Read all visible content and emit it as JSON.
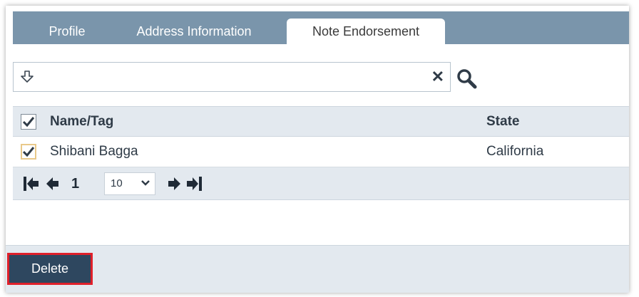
{
  "tabs": [
    {
      "label": "Profile",
      "active": false
    },
    {
      "label": "Address Information",
      "active": false
    },
    {
      "label": "Note Endorsement",
      "active": true
    }
  ],
  "search": {
    "value": "",
    "filter_icon": "filter-arrow-icon",
    "clear_icon": "close-icon",
    "search_icon": "search-icon"
  },
  "grid": {
    "columns": [
      "Name/Tag",
      "State"
    ],
    "header_checked": true,
    "rows": [
      {
        "name": "Shibani Bagga",
        "state": "California",
        "checked": true
      }
    ]
  },
  "pager": {
    "page": "1",
    "page_size": "10"
  },
  "footer": {
    "delete_label": "Delete"
  },
  "colors": {
    "tabbar": "#7a95ab",
    "grid_header": "#e3e9ef",
    "button": "#2e475f",
    "highlight": "#e0202a"
  }
}
